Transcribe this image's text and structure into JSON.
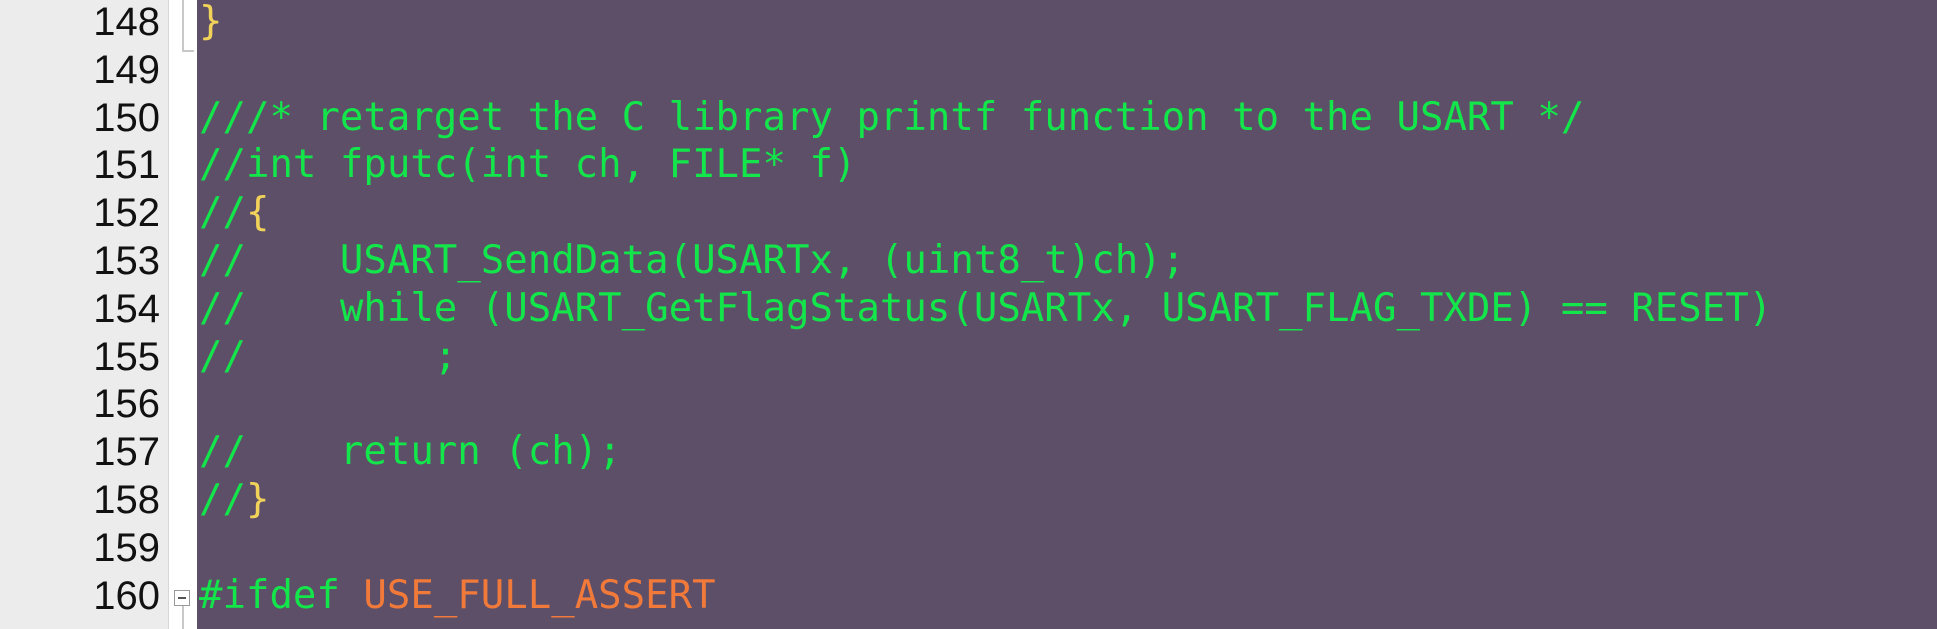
{
  "lines": [
    {
      "number": "148",
      "segments": [
        {
          "text": "}",
          "kind": "brace"
        }
      ]
    },
    {
      "number": "149",
      "segments": []
    },
    {
      "number": "150",
      "segments": [
        {
          "text": "///* retarget the C library printf function to the USART */",
          "kind": "comment"
        }
      ]
    },
    {
      "number": "151",
      "segments": [
        {
          "text": "//int fputc(int ch, FILE* f)",
          "kind": "comment"
        }
      ]
    },
    {
      "number": "152",
      "segments": [
        {
          "text": "//",
          "kind": "comment"
        },
        {
          "text": "{",
          "kind": "brace"
        }
      ]
    },
    {
      "number": "153",
      "segments": [
        {
          "text": "//    USART_SendData(USARTx, (uint8_t)ch);",
          "kind": "comment"
        }
      ]
    },
    {
      "number": "154",
      "segments": [
        {
          "text": "//    while (USART_GetFlagStatus(USARTx, USART_FLAG_TXDE) == RESET)",
          "kind": "comment"
        }
      ]
    },
    {
      "number": "155",
      "segments": [
        {
          "text": "//        ;",
          "kind": "comment"
        }
      ]
    },
    {
      "number": "156",
      "segments": []
    },
    {
      "number": "157",
      "segments": [
        {
          "text": "//    return (ch);",
          "kind": "comment"
        }
      ]
    },
    {
      "number": "158",
      "segments": [
        {
          "text": "//",
          "kind": "comment"
        },
        {
          "text": "}",
          "kind": "brace"
        }
      ]
    },
    {
      "number": "159",
      "segments": []
    },
    {
      "number": "160",
      "segments": [
        {
          "text": "#ifdef ",
          "kind": "comment"
        },
        {
          "text": "USE_FULL_ASSERT",
          "kind": "macro"
        }
      ]
    }
  ],
  "colors": {
    "background": "#5e4f68",
    "gutter": "#ececec",
    "comment": "#13e64a",
    "brace": "#f2d35a",
    "macro": "#f17a3a"
  }
}
